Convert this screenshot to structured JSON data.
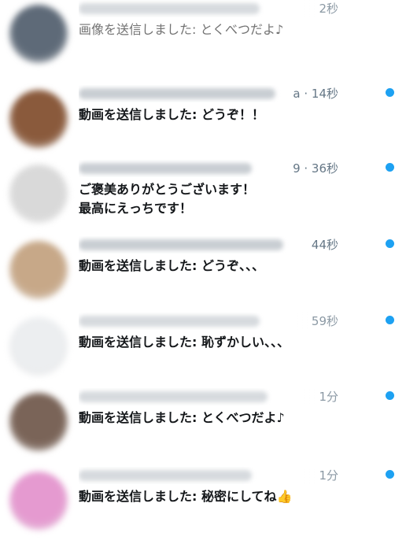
{
  "accent": "#1da1f2",
  "conversations": [
    {
      "timestamp": "2秒",
      "message": "画像を送信しました: とくべつだよ♪",
      "unread": false,
      "avatar_color": "#5e6a78"
    },
    {
      "timestamp": "a · 14秒",
      "message": "動画を送信しました: どうぞ！！",
      "unread": true,
      "avatar_color": "#8a5a3c"
    },
    {
      "timestamp": "9 · 36秒",
      "message": "ご褒美ありがとうございます！\n最高にえっちです！",
      "unread": true,
      "avatar_color": "#d9d9d9"
    },
    {
      "timestamp": "44秒",
      "message": "動画を送信しました: どうぞ、、、",
      "unread": true,
      "avatar_color": "#c7a888"
    },
    {
      "timestamp": "59秒",
      "message": "動画を送信しました: 恥ずかしい、、、",
      "unread": true,
      "avatar_color": "#eceef0"
    },
    {
      "timestamp": "1分",
      "message": "動画を送信しました: とくべつだよ♪",
      "unread": true,
      "avatar_color": "#7a6458"
    },
    {
      "timestamp": "1分",
      "message": "動画を送信しました: 秘密にしてね👍",
      "unread": true,
      "avatar_color": "#e59ad0"
    }
  ]
}
